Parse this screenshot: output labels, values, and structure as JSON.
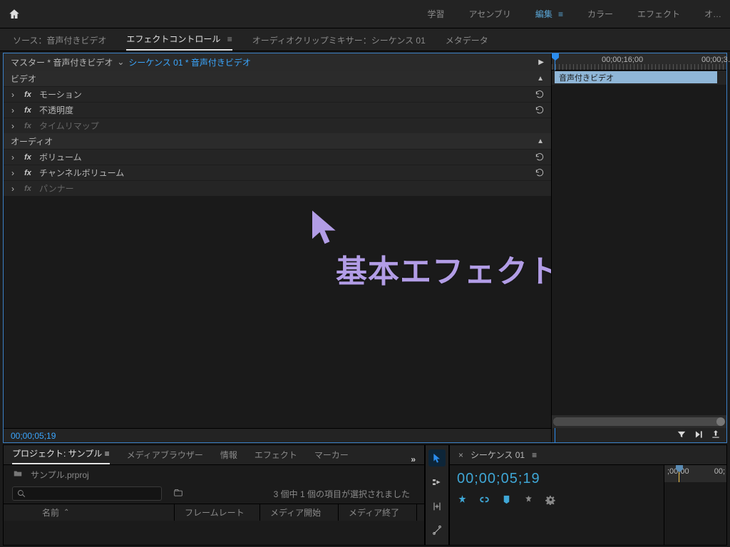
{
  "workspace_tabs": [
    "学習",
    "アセンブリ",
    "編集",
    "カラー",
    "エフェクト",
    "オ…"
  ],
  "workspace_active": "編集",
  "panel_tabs": [
    {
      "label": "ソース：音声付きビデオ"
    },
    {
      "label": "エフェクトコントロール",
      "active": true
    },
    {
      "label": "オーディオクリップミキサー：シーケンス 01"
    },
    {
      "label": "メタデータ"
    }
  ],
  "clip_header": {
    "master": "マスター * 音声付きビデオ",
    "path": "シーケンス 01 * 音声付きビデオ"
  },
  "mini_ruler": {
    "labels": [
      "00;00;16;00",
      "00;00;3…"
    ],
    "clip_label": "音声付きビデオ"
  },
  "sections": {
    "video": {
      "title": "ビデオ",
      "rows": [
        {
          "label": "モーション",
          "reset": true
        },
        {
          "label": "不透明度",
          "reset": true
        },
        {
          "label": "タイムリマップ",
          "dim": true
        }
      ]
    },
    "audio": {
      "title": "オーディオ",
      "rows": [
        {
          "label": "ボリューム",
          "reset": true
        },
        {
          "label": "チャンネルボリューム",
          "reset": true
        },
        {
          "label": "パンナー",
          "dim": true
        }
      ]
    }
  },
  "footer_timecode": "00;00;05;19",
  "annotation": "基本エフェクト",
  "project": {
    "tabs": [
      "プロジェクト: サンプル",
      "メディアブラウザー",
      "情報",
      "エフェクト",
      "マーカー"
    ],
    "active": "プロジェクト: サンプル",
    "filename": "サンプル.prproj",
    "selection_info": "3 個中 1 個の項目が選択されました",
    "columns": [
      "名前",
      "フレームレート",
      "メディア開始",
      "メディア終了"
    ]
  },
  "timeline": {
    "tab": "シーケンス 01",
    "timecode": "00;00;05;19",
    "ruler_labels": [
      ";00;00",
      "00;"
    ]
  }
}
